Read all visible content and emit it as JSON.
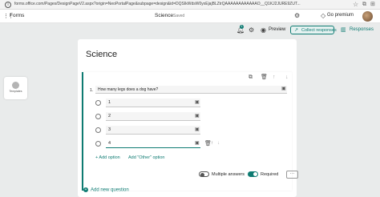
{
  "browser": {
    "url": "forms.office.com/Pages/DesignPageV2.aspx?origin=NeoPortalPage&subpage=design&id=DQSIkWdsW0yxEjajBLZtrQAAAAAAAAAAAAO__Q1KJ2JURE9ZUT..."
  },
  "app": {
    "name": "Forms",
    "doc_title": "Science",
    "doc_dash": "-",
    "doc_status": "Saved",
    "premium_label": "Go premium",
    "notification_count": "1"
  },
  "toolbar": {
    "preview_label": "Preview",
    "collect_label": "Collect responses",
    "responses_label": "Responses"
  },
  "sidebar": {
    "themes_label": "Templates"
  },
  "form": {
    "title": "Science",
    "question": {
      "number": "1.",
      "text": "How many legs does a dog have?",
      "options": [
        "1",
        "2",
        "3",
        "4"
      ],
      "add_option_label": "+ Add option",
      "add_other_label": "Add \"Other\" option",
      "multiple_answers_label": "Multiple answers",
      "required_label": "Required",
      "more_label": "···"
    },
    "add_question_label": "Add new question"
  },
  "colors": {
    "accent": "#0e7b72"
  }
}
